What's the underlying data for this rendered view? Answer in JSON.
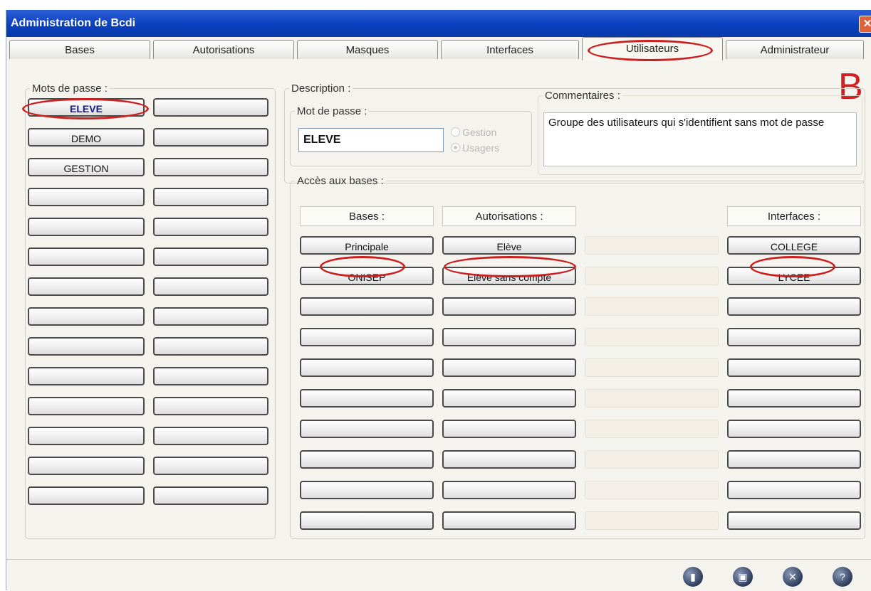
{
  "window": {
    "title": "Administration de Bcdi",
    "close_symbol": "✕"
  },
  "tabs": [
    {
      "label": "Bases"
    },
    {
      "label": "Autorisations"
    },
    {
      "label": "Masques"
    },
    {
      "label": "Interfaces"
    },
    {
      "label": "Utilisateurs"
    },
    {
      "label": "Administrateur"
    }
  ],
  "active_tab": "Utilisateurs",
  "annotation_letter": "B",
  "passwords": {
    "legend": "Mots de passe :",
    "items": [
      "ELEVE",
      "DEMO",
      "GESTION",
      "",
      "",
      "",
      "",
      "",
      "",
      "",
      "",
      "",
      "",
      ""
    ],
    "selected": "ELEVE"
  },
  "description": {
    "legend": "Description :",
    "mot_de_passe_legend": "Mot de passe :",
    "mot_de_passe_value": "ELEVE",
    "radio_gestion": "Gestion",
    "radio_usagers": "Usagers",
    "radio_selected": "Usagers",
    "comments_legend": "Commentaires :",
    "comments_text": "Groupe des utilisateurs qui s'identifient sans mot de passe"
  },
  "acces": {
    "legend": "Accès aux bases :",
    "headers": {
      "bases": "Bases :",
      "autorisations": "Autorisations :",
      "interfaces": "Interfaces :"
    },
    "rows": [
      {
        "base": "Principale",
        "autorisation": "Elève",
        "interface": "COLLEGE"
      },
      {
        "base": "ONISEP",
        "autorisation": "Elève sans compte",
        "interface": "LYCEE"
      },
      {
        "base": "",
        "autorisation": "",
        "interface": ""
      },
      {
        "base": "",
        "autorisation": "",
        "interface": ""
      },
      {
        "base": "",
        "autorisation": "",
        "interface": ""
      },
      {
        "base": "",
        "autorisation": "",
        "interface": ""
      },
      {
        "base": "",
        "autorisation": "",
        "interface": ""
      },
      {
        "base": "",
        "autorisation": "",
        "interface": ""
      },
      {
        "base": "",
        "autorisation": "",
        "interface": ""
      },
      {
        "base": "",
        "autorisation": "",
        "interface": ""
      }
    ]
  },
  "toolbar_icons": [
    "notes-icon",
    "save-icon",
    "close-icon",
    "help-icon"
  ],
  "colors": {
    "titlebar": "#0a3fc0",
    "highlight": "#cc2020",
    "selected_text": "#1a1a8c"
  }
}
